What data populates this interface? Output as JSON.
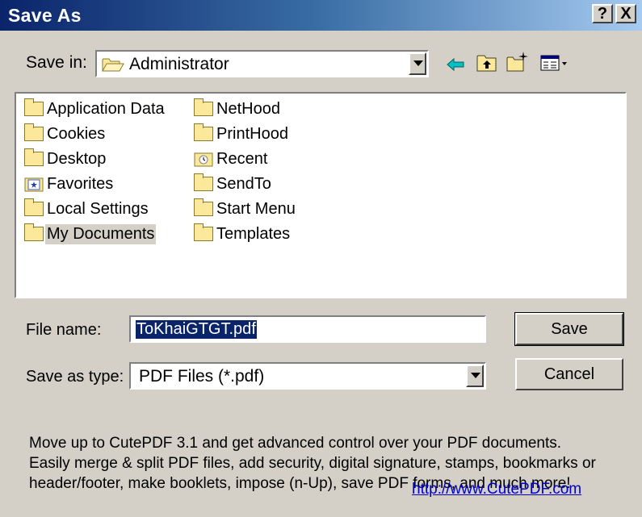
{
  "window": {
    "title": "Save As",
    "help_glyph": "?",
    "close_glyph": "X"
  },
  "save_in": {
    "label": "Save in:",
    "value": "Administrator",
    "icon": "folder-open-icon"
  },
  "toolbar": {
    "icons": [
      "back-arrow-icon",
      "up-one-level-icon",
      "new-folder-icon",
      "view-menu-icon"
    ]
  },
  "files": {
    "column1": [
      {
        "name": "Application Data",
        "icon": "folder-icon"
      },
      {
        "name": "Cookies",
        "icon": "folder-icon"
      },
      {
        "name": "Desktop",
        "icon": "folder-icon"
      },
      {
        "name": "Favorites",
        "icon": "favorites-folder-icon"
      },
      {
        "name": "Local Settings",
        "icon": "folder-icon"
      },
      {
        "name": "My Documents",
        "icon": "folder-icon",
        "selected": true
      }
    ],
    "column2": [
      {
        "name": "NetHood",
        "icon": "folder-icon"
      },
      {
        "name": "PrintHood",
        "icon": "folder-icon"
      },
      {
        "name": "Recent",
        "icon": "recent-folder-icon"
      },
      {
        "name": "SendTo",
        "icon": "folder-icon"
      },
      {
        "name": "Start Menu",
        "icon": "folder-icon"
      },
      {
        "name": "Templates",
        "icon": "folder-icon"
      }
    ]
  },
  "file_name": {
    "label": "File name:",
    "value": "ToKhaiGTGT.pdf"
  },
  "save_as_type": {
    "label": "Save as type:",
    "value": "PDF Files (*.pdf)"
  },
  "buttons": {
    "save": "Save",
    "cancel": "Cancel"
  },
  "promo": {
    "line1": "Move up to CutePDF 3.1 and get advanced control over your PDF documents.",
    "line2": "Easily merge & split PDF files, add security, digital signature, stamps, bookmarks or",
    "line3": "header/footer, make booklets, impose (n-Up), save PDF forms, and much more!",
    "link": "http://www.CutePDF.com"
  },
  "colors": {
    "titlebar_start": "#0a246a",
    "titlebar_end": "#a6caf0",
    "dialog_bg": "#d4d0c8",
    "selection": "#0a246a",
    "link": "#0000cc"
  }
}
